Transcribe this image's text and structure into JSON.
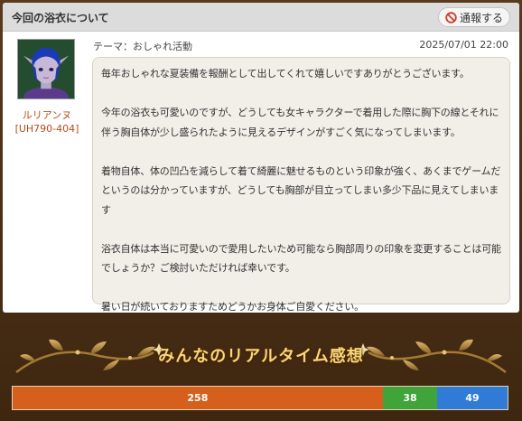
{
  "card": {
    "title": "今回の浴衣について",
    "report_label": "通報する"
  },
  "post": {
    "user_name": "ルリアンヌ",
    "user_id": "[UH790-404]",
    "theme": "テーマ：おしゃれ活動",
    "date": "2025/07/01 22:00",
    "paragraphs": [
      "毎年おしゃれな夏装備を報酬として出してくれて嬉しいですありがとうございます。",
      "今年の浴衣も可愛いのですが、どうしても女キャラクターで着用した際に胸下の線とそれに伴う胸自体が少し盛られたように見えるデザインがすごく気になってしまいます。",
      "着物自体、体の凹凸を減らして着て綺麗に魅せるものという印象が強く、あくまでゲームだというのは分かっていますが、どうしても胸部が目立ってしまい多少下品に見えてしまいます",
      "浴衣自体は本当に可愛いので愛用したいため可能なら胸部周りの印象を変更することは可能でしょうか？ご検討いただければ幸いです。",
      "暑い日が続いておりますためどうかお身体ご自愛ください。"
    ]
  },
  "banner": {
    "title": "みんなのリアルタイム感想"
  },
  "votes": [
    {
      "label": "258",
      "count": 258,
      "color": "#d65f1c"
    },
    {
      "label": "38",
      "count": 38,
      "color": "#40a43a"
    },
    {
      "label": "49",
      "count": 49,
      "color": "#2f7bd6"
    }
  ],
  "colors": {
    "frame": "#4a2f16",
    "header_bg": "#dcdcdc",
    "bubble_bg": "#f1efe8",
    "user_name": "#b84a1a",
    "banner_text": "#f7d77a"
  },
  "icons": {
    "report": "prohibited-icon",
    "avatar": "elf-character-avatar",
    "banner_decoration": "vine-ornament"
  }
}
